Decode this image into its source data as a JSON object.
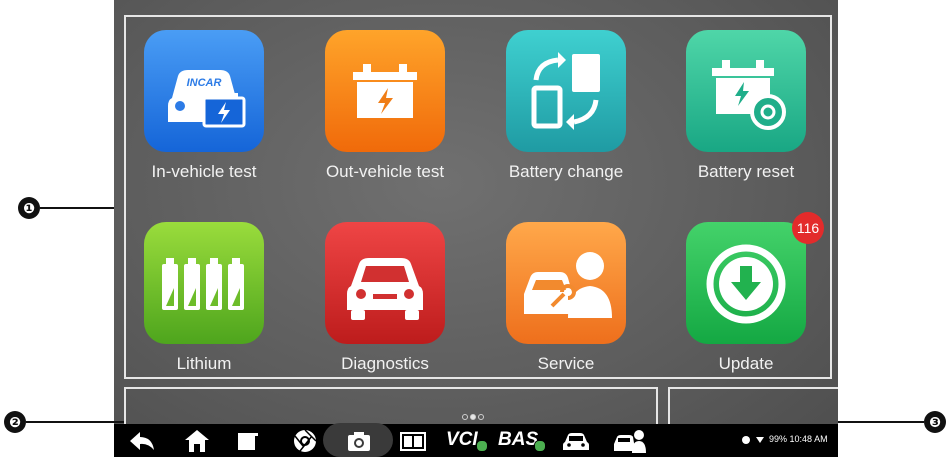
{
  "apps": [
    {
      "label": "In-vehicle test",
      "icon": "in-vehicle-test-icon",
      "colors": [
        "#4a9df5",
        "#1565d8"
      ]
    },
    {
      "label": "Out-vehicle test",
      "icon": "out-vehicle-test-icon",
      "colors": [
        "#ffa42a",
        "#f06a0a"
      ]
    },
    {
      "label": "Battery change",
      "icon": "battery-change-icon",
      "colors": [
        "#3fd0d0",
        "#1f9ba3"
      ]
    },
    {
      "label": "Battery reset",
      "icon": "battery-reset-icon",
      "colors": [
        "#4fd6a8",
        "#19a784"
      ]
    },
    {
      "label": "Lithium",
      "icon": "lithium-icon",
      "colors": [
        "#9adc3c",
        "#4ea51d"
      ]
    },
    {
      "label": "Diagnostics",
      "icon": "diagnostics-icon",
      "colors": [
        "#ef4545",
        "#bd1c1c"
      ]
    },
    {
      "label": "Service",
      "icon": "service-icon",
      "colors": [
        "#ffa84a",
        "#ee6f1c"
      ]
    },
    {
      "label": "Update",
      "icon": "update-icon",
      "colors": [
        "#44d26a",
        "#14a843"
      ]
    }
  ],
  "update_badge": "116",
  "in_vehicle_logo_text": "INCAR",
  "callouts": {
    "c1": "❶",
    "c2": "❷",
    "c3": "❸"
  },
  "navbar": {
    "vci_text": "VCI",
    "bas_text": "BAS",
    "status_text": "99%  10:48 AM",
    "icons": [
      "back-icon",
      "home-icon",
      "recent-apps-icon",
      "browser-icon",
      "camera-icon",
      "screen-mirror-icon",
      "vci-icon",
      "bas-icon",
      "car-icon",
      "service-icon"
    ]
  },
  "page_indicator": {
    "pages": 3,
    "active": 1
  }
}
